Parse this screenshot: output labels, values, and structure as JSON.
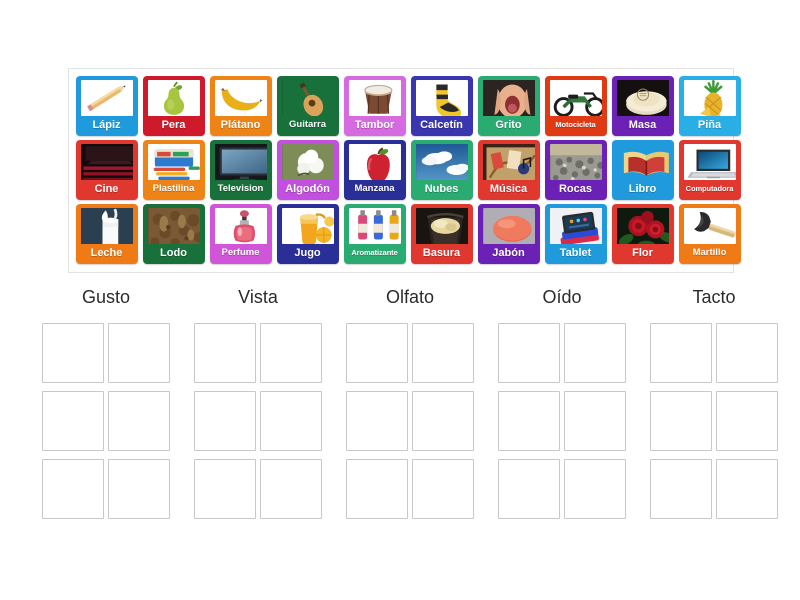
{
  "activity": {
    "type": "group-sort",
    "tile_rows": [
      [
        {
          "label": "Lápiz",
          "icon": "pencil-icon",
          "color": "#1f9bdd",
          "img_bg": "light",
          "label_size": "normal"
        },
        {
          "label": "Pera",
          "icon": "pear-icon",
          "color": "#cf1a2b",
          "img_bg": "light",
          "label_size": "normal"
        },
        {
          "label": "Plátano",
          "icon": "banana-icon",
          "color": "#ef8416",
          "img_bg": "light",
          "label_size": "normal"
        },
        {
          "label": "Guitarra",
          "icon": "guitar-icon",
          "color": "#18713a",
          "img_bg": "dark",
          "label_size": "small"
        },
        {
          "label": "Tambor",
          "icon": "drum-icon",
          "color": "#d66ae0",
          "img_bg": "light",
          "label_size": "normal"
        },
        {
          "label": "Calcetín",
          "icon": "sock-icon",
          "color": "#3a36b0",
          "img_bg": "light",
          "label_size": "normal"
        },
        {
          "label": "Grito",
          "icon": "shout-icon",
          "color": "#2aab72",
          "img_bg": "dark",
          "label_size": "normal"
        },
        {
          "label": "Motocicleta",
          "icon": "motorcycle-icon",
          "color": "#e03a15",
          "img_bg": "light",
          "label_size": "tiny"
        },
        {
          "label": "Masa",
          "icon": "dough-icon",
          "color": "#6b21b5",
          "img_bg": "dark",
          "label_size": "normal"
        },
        {
          "label": "Piña",
          "icon": "pineapple-icon",
          "color": "#29aee6",
          "img_bg": "light",
          "label_size": "normal"
        }
      ],
      [
        {
          "label": "Cine",
          "icon": "cinema-icon",
          "color": "#e0372f",
          "img_bg": "dark",
          "label_size": "normal"
        },
        {
          "label": "Plastilina",
          "icon": "clay-icon",
          "color": "#ef8416",
          "img_bg": "light",
          "label_size": "small"
        },
        {
          "label": "Television",
          "icon": "television-icon",
          "color": "#18713a",
          "img_bg": "dark",
          "label_size": "small"
        },
        {
          "label": "Algodón",
          "icon": "cotton-icon",
          "color": "#c34fe0",
          "img_bg": "dark",
          "label_size": "normal"
        },
        {
          "label": "Manzana",
          "icon": "apple-icon",
          "color": "#2a2f97",
          "img_bg": "light",
          "label_size": "small"
        },
        {
          "label": "Nubes",
          "icon": "clouds-icon",
          "color": "#2aab72",
          "img_bg": "dark",
          "label_size": "normal"
        },
        {
          "label": "Música",
          "icon": "music-icon",
          "color": "#e0372f",
          "img_bg": "dark",
          "label_size": "normal"
        },
        {
          "label": "Rocas",
          "icon": "rocks-icon",
          "color": "#6b21b5",
          "img_bg": "dark",
          "label_size": "normal"
        },
        {
          "label": "Libro",
          "icon": "book-icon",
          "color": "#1f9bdd",
          "img_bg": "none",
          "label_size": "normal"
        },
        {
          "label": "Computadora",
          "icon": "laptop-icon",
          "color": "#e0372f",
          "img_bg": "light",
          "label_size": "tiny"
        }
      ],
      [
        {
          "label": "Leche",
          "icon": "milk-icon",
          "color": "#ef7a16",
          "img_bg": "dark",
          "label_size": "normal"
        },
        {
          "label": "Lodo",
          "icon": "mud-icon",
          "color": "#18713a",
          "img_bg": "dark",
          "label_size": "normal"
        },
        {
          "label": "Perfume",
          "icon": "perfume-icon",
          "color": "#d055d9",
          "img_bg": "light",
          "label_size": "small"
        },
        {
          "label": "Jugo",
          "icon": "juice-icon",
          "color": "#2a2f97",
          "img_bg": "light",
          "label_size": "normal"
        },
        {
          "label": "Aromatizante",
          "icon": "air-freshener-icon",
          "color": "#2aab72",
          "img_bg": "light",
          "label_size": "tiny"
        },
        {
          "label": "Basura",
          "icon": "trash-icon",
          "color": "#e0372f",
          "img_bg": "dark",
          "label_size": "normal"
        },
        {
          "label": "Jabón",
          "icon": "soap-icon",
          "color": "#6b21b5",
          "img_bg": "dark",
          "label_size": "normal"
        },
        {
          "label": "Tablet",
          "icon": "tablet-icon",
          "color": "#1f9bdd",
          "img_bg": "light",
          "label_size": "normal"
        },
        {
          "label": "Flor",
          "icon": "flower-icon",
          "color": "#e0372f",
          "img_bg": "dark",
          "label_size": "normal"
        },
        {
          "label": "Martillo",
          "icon": "hammer-icon",
          "color": "#ef7a16",
          "img_bg": "light",
          "label_size": "small"
        }
      ]
    ],
    "categories": [
      {
        "title": "Gusto",
        "slots": 6
      },
      {
        "title": "Vista",
        "slots": 6
      },
      {
        "title": "Olfato",
        "slots": 6
      },
      {
        "title": "Oído",
        "slots": 6
      },
      {
        "title": "Tacto",
        "slots": 6
      }
    ]
  }
}
